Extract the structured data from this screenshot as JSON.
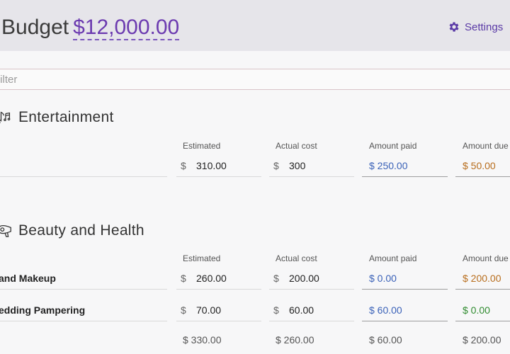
{
  "header": {
    "title": "Budget",
    "amount": "$12,000.00",
    "settings_label": "Settings"
  },
  "filter": {
    "placeholder": "Filter"
  },
  "columns": {
    "estimated": "Estimated",
    "actual": "Actual cost",
    "paid": "Amount paid",
    "due": "Amount due"
  },
  "currency": "$",
  "sections": [
    {
      "title": "Entertainment",
      "icon": "music-notes-icon",
      "rows": [
        {
          "name": "",
          "estimated": "310.00",
          "actual": "300",
          "paid": "$ 250.00",
          "due": "$ 50.00"
        }
      ]
    },
    {
      "title": "Beauty and Health",
      "icon": "hair-dryer-icon",
      "rows": [
        {
          "name": "and Makeup",
          "estimated": "260.00",
          "actual": "200.00",
          "paid": "$ 0.00",
          "due": "$ 200.00"
        },
        {
          "name": "edding Pampering",
          "estimated": "70.00",
          "actual": "60.00",
          "paid": "$ 60.00",
          "due": "$ 0.00"
        }
      ],
      "totals": {
        "estimated": "$ 330.00",
        "actual": "$ 260.00",
        "paid": "$ 60.00",
        "due": "$ 200.00"
      }
    }
  ],
  "colors": {
    "accent": "#6c3bb0",
    "paid": "#3b62b8",
    "due_positive": "#b86e1e",
    "due_zero": "#2f8b2f"
  }
}
